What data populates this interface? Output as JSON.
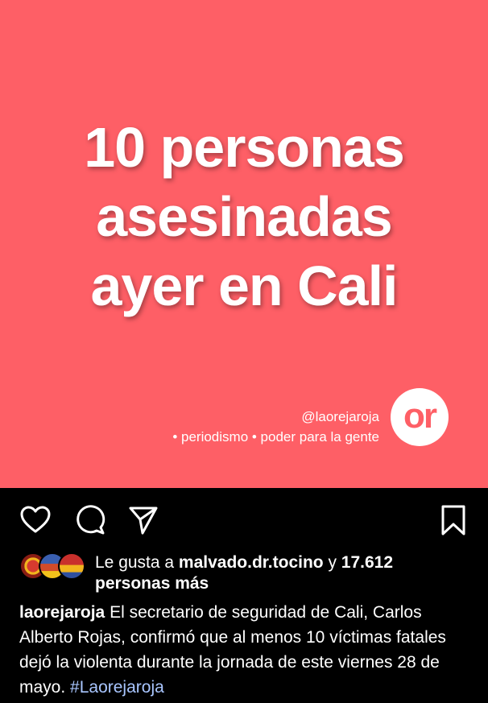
{
  "post": {
    "headline_lines": [
      "10 personas",
      "asesinadas",
      "ayer en Cali"
    ],
    "handle": "@laorejaroja",
    "tagline": "• periodismo •  poder para la gente",
    "logo_text": "or",
    "background_color": "#fe5f66"
  },
  "actions": {
    "like_icon": "heart-icon",
    "comment_icon": "comment-icon",
    "share_icon": "send-icon",
    "save_icon": "bookmark-icon"
  },
  "likes": {
    "prefix": "Le gusta a ",
    "user": "malvado.dr.tocino",
    "connector": " y ",
    "count": "17.612",
    "suffix": "personas más"
  },
  "caption": {
    "username": "laorejaroja",
    "text": " El secretario de seguridad de Cali, Carlos Alberto Rojas, confirmó que al menos 10 víctimas fatales dejó la violenta durante la jornada de este viernes 28 de mayo. ",
    "hashtag": "#Laorejaroja"
  }
}
